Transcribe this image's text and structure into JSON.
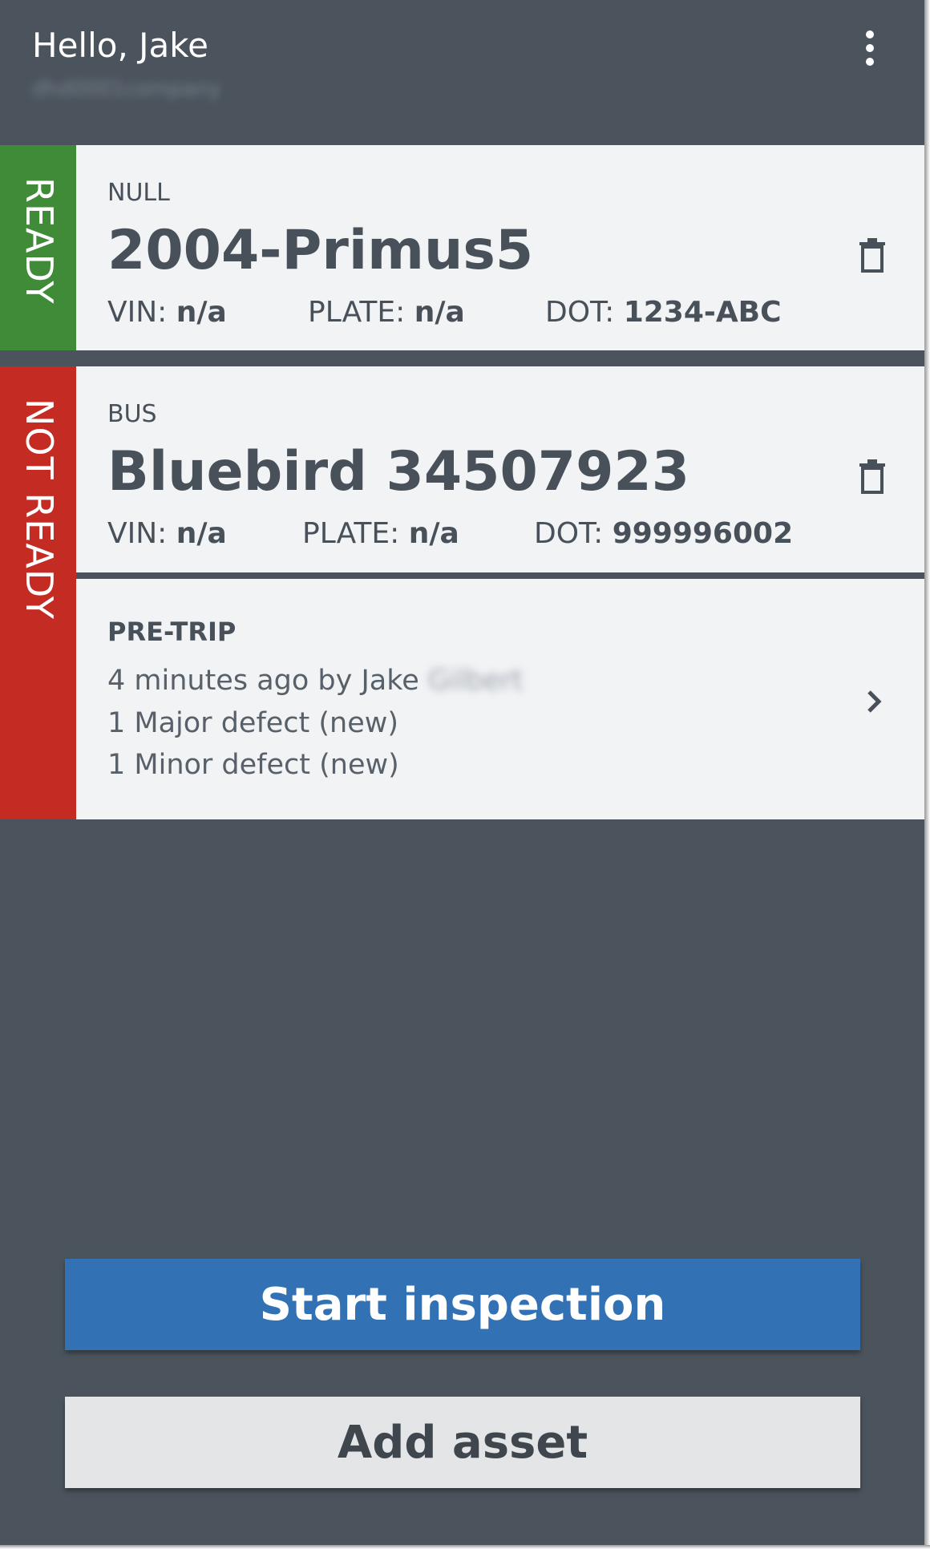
{
  "header": {
    "greeting": "Hello, Jake",
    "account": "dhd0001company",
    "menu_icon": "more-vertical-icon"
  },
  "assets": [
    {
      "status": "READY",
      "status_color": "#3f8b37",
      "type": "NULL",
      "name": "2004-Primus5",
      "vin_label": "VIN:",
      "vin": "n/a",
      "plate_label": "PLATE:",
      "plate": "n/a",
      "dot_label": "DOT:",
      "dot": "1234-ABC",
      "delete_icon": "trash-icon"
    },
    {
      "status": "NOT READY",
      "status_color": "#c42b22",
      "type": "BUS",
      "name": "Bluebird 34507923",
      "vin_label": "VIN:",
      "vin": "n/a",
      "plate_label": "PLATE:",
      "plate": "n/a",
      "dot_label": "DOT:",
      "dot": "999996002",
      "delete_icon": "trash-icon",
      "inspection": {
        "title": "PRE-TRIP",
        "when_by": "4 minutes ago by Jake",
        "lastname_blurred": "Gilbert",
        "major": "1 Major defect (new)",
        "minor": "1 Minor defect (new)",
        "chevron_icon": "chevron-right-icon"
      }
    }
  ],
  "actions": {
    "start_inspection": "Start inspection",
    "add_asset": "Add asset",
    "primary_color": "#3272b4"
  }
}
